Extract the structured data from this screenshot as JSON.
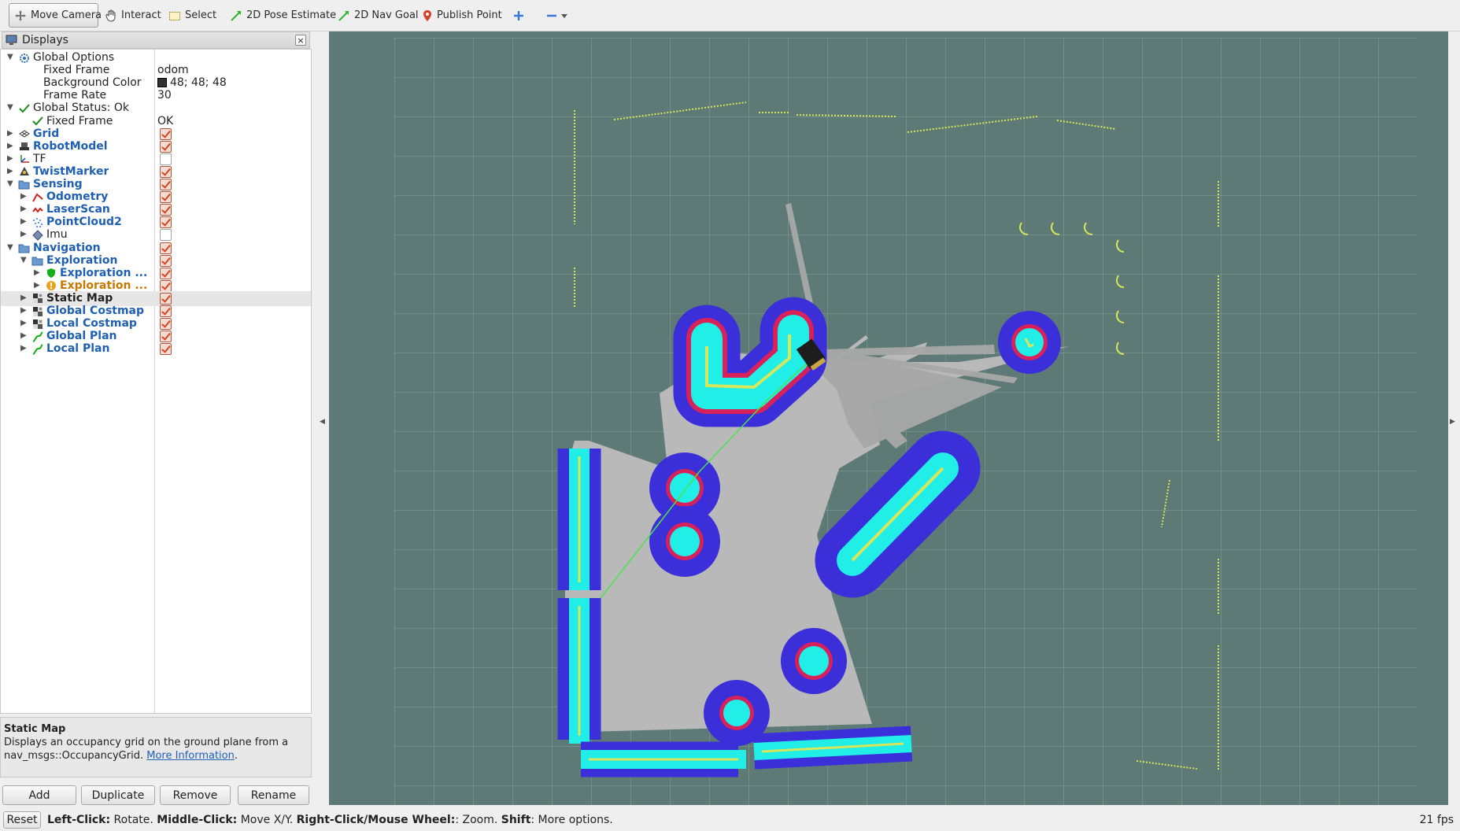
{
  "toolbar": {
    "move_camera": "Move Camera",
    "interact": "Interact",
    "select": "Select",
    "pose_estimate": "2D Pose Estimate",
    "nav_goal": "2D Nav Goal",
    "publish_point": "Publish Point"
  },
  "displays_panel": {
    "title": "Displays",
    "rows": [
      {
        "label": "Global Options",
        "icon": "gear-icon",
        "expanded": true,
        "value": ""
      },
      {
        "label": "Fixed Frame",
        "value": "odom"
      },
      {
        "label": "Background Color",
        "value": "48; 48; 48",
        "swatch": "#303030"
      },
      {
        "label": "Frame Rate",
        "value": "30"
      },
      {
        "label": "Global Status: Ok",
        "icon": "check-icon",
        "expanded": true
      },
      {
        "label": "Fixed Frame",
        "icon": "check-icon",
        "value": "OK"
      },
      {
        "label": "Grid",
        "icon": "grid-icon",
        "checked": true
      },
      {
        "label": "RobotModel",
        "icon": "robot-icon",
        "checked": true
      },
      {
        "label": "TF",
        "icon": "axes-icon",
        "checked": false
      },
      {
        "label": "TwistMarker",
        "icon": "marker-icon",
        "checked": true
      },
      {
        "label": "Sensing",
        "icon": "folder-icon",
        "checked": true,
        "expanded": true
      },
      {
        "label": "Odometry",
        "icon": "odometry-icon",
        "checked": true
      },
      {
        "label": "LaserScan",
        "icon": "laserscan-icon",
        "checked": true
      },
      {
        "label": "PointCloud2",
        "icon": "pointcloud-icon",
        "checked": true
      },
      {
        "label": "Imu",
        "icon": "imu-icon",
        "checked": false
      },
      {
        "label": "Navigation",
        "icon": "folder-icon",
        "checked": true,
        "expanded": true
      },
      {
        "label": "Exploration",
        "icon": "folder-icon",
        "checked": true,
        "expanded": true
      },
      {
        "label": "Exploration ...",
        "icon": "shield-icon",
        "checked": true
      },
      {
        "label": "Exploration ...",
        "icon": "warning-icon",
        "checked": true
      },
      {
        "label": "Static Map",
        "icon": "map-icon",
        "checked": true
      },
      {
        "label": "Global Costmap",
        "icon": "map-icon",
        "checked": true
      },
      {
        "label": "Local Costmap",
        "icon": "map-icon",
        "checked": true
      },
      {
        "label": "Global Plan",
        "icon": "path-icon",
        "checked": true
      },
      {
        "label": "Local Plan",
        "icon": "path-icon",
        "checked": true
      }
    ]
  },
  "description": {
    "title": "Static Map",
    "text": "Displays an occupancy grid on the ground plane from a nav_msgs::OccupancyGrid.",
    "link": "More Information",
    "period": "."
  },
  "buttons": {
    "add": "Add",
    "duplicate": "Duplicate",
    "remove": "Remove",
    "rename": "Rename"
  },
  "statusbar": {
    "reset": "Reset",
    "left_click": "Left-Click:",
    "left_click_desc": " Rotate. ",
    "middle_click": "Middle-Click:",
    "middle_click_desc": " Move X/Y. ",
    "right_click": "Right-Click/Mouse Wheel:",
    "right_click_desc": ": Zoom. ",
    "shift": "Shift",
    "shift_desc": ": More options.",
    "fps": "21 fps"
  },
  "colors": {
    "viewport_background": "#5e7a76",
    "grid_line": "#8aa5a0",
    "free_space": "#b9b9b9",
    "costmap_blue": "#3a2fd8",
    "costmap_cyan": "#22eee8",
    "costmap_red": "#d8215a",
    "obstacle_yellow": "#d8e65a",
    "plan_green": "#4ee14e"
  }
}
